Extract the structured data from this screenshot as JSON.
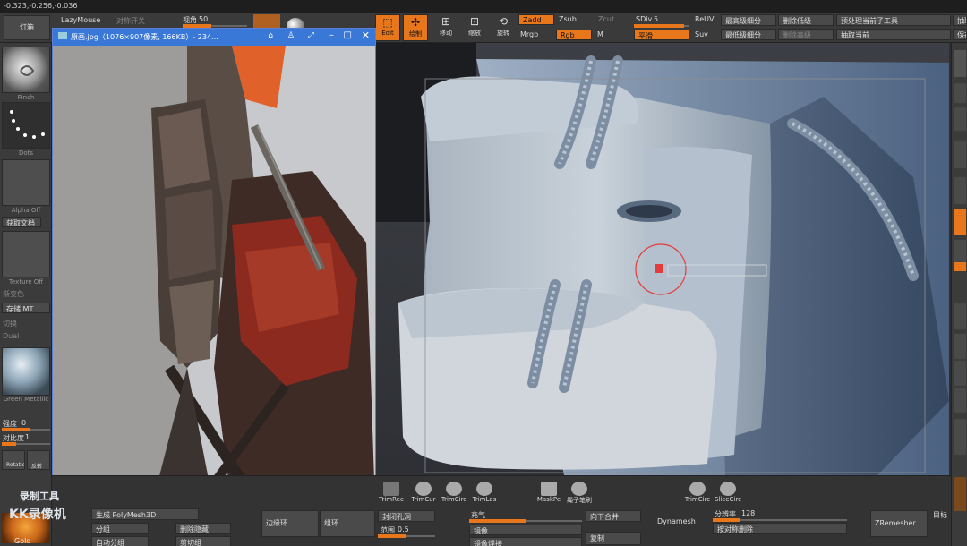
{
  "topbar": {
    "coords": "-0.323,-0.256,-0.036"
  },
  "toolbar": {
    "lightbox": "灯箱",
    "lazymouse": "LazyMouse",
    "unknown1": "对称开关",
    "angle_label": "视角",
    "angle_value": "50",
    "edit": "Edit",
    "draw": "绘制",
    "move": "移动",
    "scale": "缩放",
    "rotate": "旋转",
    "zadd": "Zadd",
    "zsub": "Zsub",
    "zcut": "Zcut",
    "mrgb": "Mrgb",
    "rgb": "Rgb",
    "m": "M",
    "sdiv_label": "SDiv",
    "sdiv_value": "5",
    "smooth": "平滑",
    "reuv": "ReUV",
    "suv": "Suv",
    "highest": "最高级细分",
    "delete_lower": "删除低级",
    "lowest": "最低级细分",
    "delete_higher": "删除高级",
    "preprocess": "预处理当前子工具",
    "extract": "抽取当前",
    "extract2": "抽取",
    "save": "保存"
  },
  "left": {
    "brush_name": "Pinch",
    "stroke_name": "Dots",
    "alpha_name": "Alpha Off",
    "get_doc": "获取文档",
    "texture_name": "Texture Off",
    "gradient": "渐变色",
    "save_mt": "存储 MT",
    "switch": "切换",
    "dual": "Dual",
    "material_name": "Green Metallic",
    "intensity_label": "强度",
    "intensity_value": "0",
    "contrast_label": "对比度",
    "contrast_value": "1",
    "rotation": "Rotation",
    "reverse": "反转",
    "gold": "Gold"
  },
  "refwin": {
    "title": "原画.jpg（1076×907像素, 166KB）- 234..."
  },
  "bottom": {
    "trimrect": "TrimRec",
    "trimcurve": "TrimCur",
    "trimcircle": "TrimCirc",
    "trimlasso": "TrimLas",
    "maskpen": "MaskPe",
    "rope": "绳子笔刷",
    "trimcircle2": "TrimCirc",
    "slicecircle": "SliceCirc",
    "gen_polymesh": "生成 PolyMesh3D",
    "group": "分组",
    "delete_hidden": "删除隐藏",
    "auto_group": "自动分组",
    "cut_group": "剪切组",
    "edge_loop": "边缘环",
    "loop": "组环",
    "close_holes": "封闭孔洞",
    "range_label": "范围",
    "range_value": "0.5",
    "inflate": "充气",
    "mirror": "镜像",
    "mirror_weld": "镜像焊接",
    "merge_down": "向下合并",
    "copy": "复制",
    "dynamesh": "Dynamesh",
    "resolution_label": "分辨率",
    "resolution_value": "128",
    "delete_sym": "按对称删除",
    "zremesher": "ZRemesher",
    "target": "目标",
    "watermark1": "录制工具",
    "watermark2": "KK录像机"
  }
}
